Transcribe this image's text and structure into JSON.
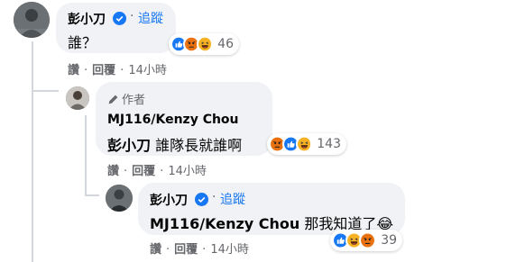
{
  "comments": [
    {
      "author": "彭小刀",
      "verified": true,
      "follow_label": "追蹤",
      "separator": "·",
      "text": "誰？",
      "reactions": [
        "like",
        "angry",
        "haha"
      ],
      "reaction_count": "46",
      "actions": {
        "like": "讚",
        "reply": "回覆",
        "time": "14小時"
      }
    },
    {
      "author_badge": "作者",
      "author": "MJ116/Kenzy Chou",
      "mention": "彭小刀",
      "text": "誰隊長就誰啊",
      "reactions": [
        "angry",
        "like",
        "haha"
      ],
      "reaction_count": "143",
      "actions": {
        "like": "讚",
        "reply": "回覆",
        "time": "14小時"
      }
    },
    {
      "author": "彭小刀",
      "verified": true,
      "follow_label": "追蹤",
      "separator": "·",
      "mention": "MJ116/Kenzy Chou",
      "text": "那我知道了😂",
      "reactions": [
        "like",
        "haha",
        "angry"
      ],
      "reaction_count": "39",
      "actions": {
        "like": "讚",
        "reply": "回覆",
        "time": "14小時"
      }
    }
  ],
  "colors": {
    "link": "#1877f2",
    "meta": "#65676b",
    "bubble": "#f0f2f5",
    "text": "#050505"
  }
}
